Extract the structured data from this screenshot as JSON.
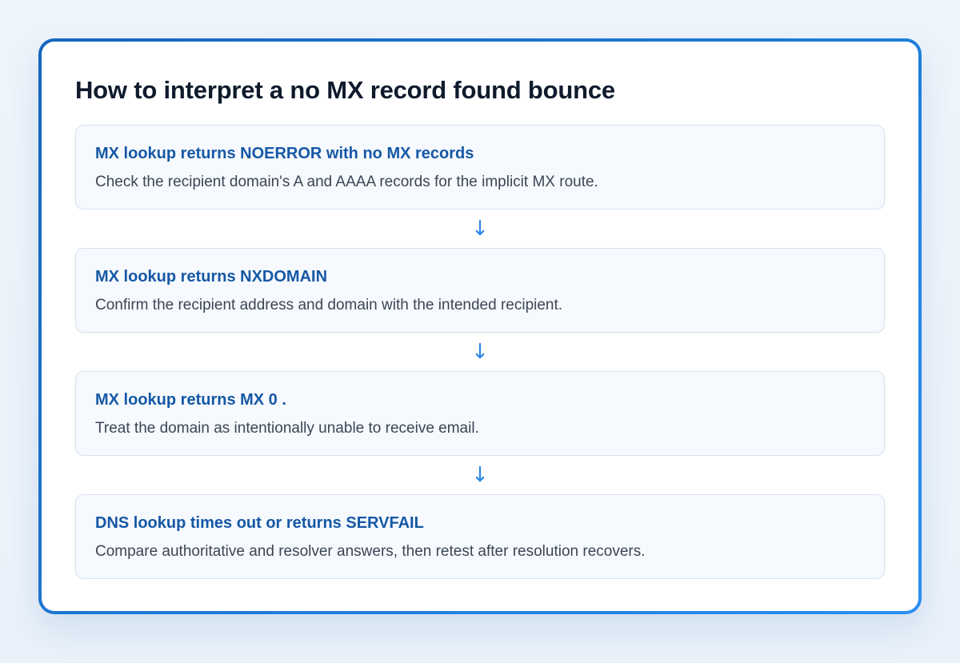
{
  "title": "How to interpret a no MX record found bounce",
  "steps": [
    {
      "title": "MX lookup returns NOERROR with no MX records",
      "description": "Check the recipient domain's A and AAAA records for the implicit MX route."
    },
    {
      "title": "MX lookup returns NXDOMAIN",
      "description": "Confirm the recipient address and domain with the intended recipient."
    },
    {
      "title": "MX lookup returns MX 0 .",
      "description": "Treat the domain as intentionally unable to receive email."
    },
    {
      "title": "DNS lookup times out or returns SERVFAIL",
      "description": "Compare authoritative and resolver answers, then retest after resolution recovers."
    }
  ],
  "arrow_glyph": "↓",
  "icons": {
    "connector": "arrow-down-icon"
  },
  "colors": {
    "frame_gradient_start": "#1565c0",
    "frame_gradient_end": "#2b8ff0",
    "step_title": "#1558a6",
    "arrow": "#2a86e8",
    "step_background": "#f6f9fd",
    "step_border": "#d6e2f0"
  }
}
